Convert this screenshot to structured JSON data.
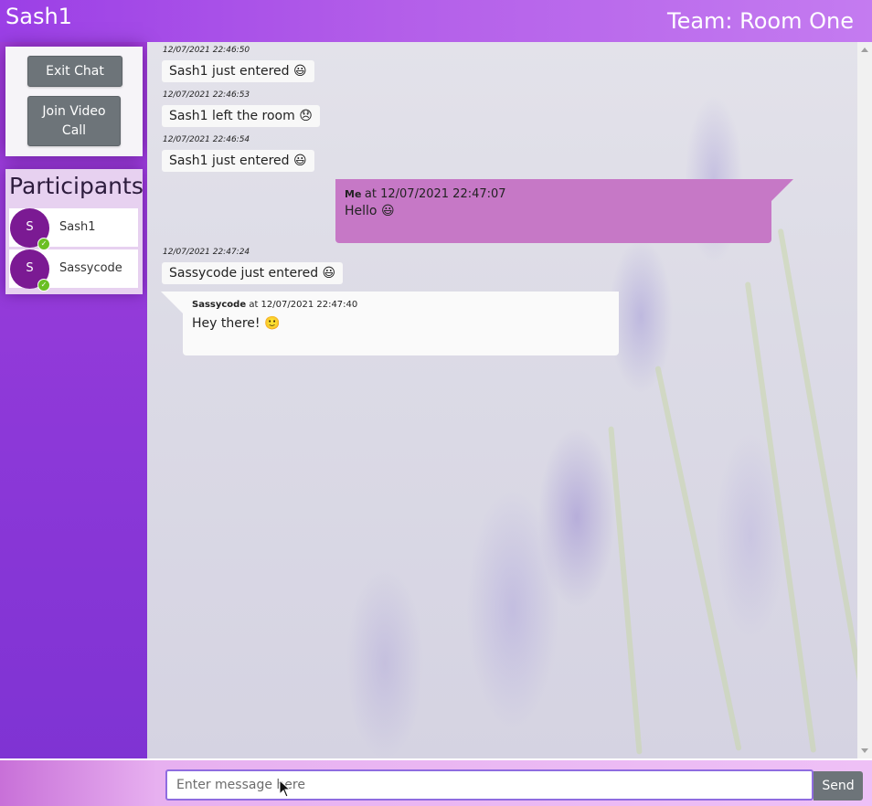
{
  "header": {
    "user_name": "Sash1",
    "team_label": "Team: Room One"
  },
  "sidebar": {
    "exit_label": "Exit Chat",
    "video_label_line1": "Join Video",
    "video_label_line2": "Call",
    "participants_title": "Participants",
    "participants": [
      {
        "initial": "S",
        "name": "Sash1",
        "status": "online"
      },
      {
        "initial": "S",
        "name": "Sassycode",
        "status": "online"
      }
    ]
  },
  "messages": {
    "system": [
      {
        "time": "12/07/2021 22:46:50",
        "text": "Sash1 just entered",
        "emoji": "😃"
      },
      {
        "time": "12/07/2021 22:46:53",
        "text": "Sash1 left the room",
        "emoji": "😞"
      },
      {
        "time": "12/07/2021 22:46:54",
        "text": "Sash1 just entered",
        "emoji": "😃"
      },
      {
        "time": "12/07/2021 22:47:24",
        "text": "Sassycode just entered",
        "emoji": "😃"
      }
    ],
    "me": {
      "sender": "Me",
      "at": "at 12/07/2021 22:47:07",
      "text": "Hello",
      "emoji": "😃",
      "color": "#c678c6"
    },
    "other": {
      "sender": "Sassycode",
      "at": "at 12/07/2021 22:47:40",
      "text": "Hey there!",
      "emoji": "🙂",
      "color": "#fafafa"
    }
  },
  "composer": {
    "placeholder": "Enter message here",
    "send_label": "Send"
  },
  "colors": {
    "accent": "#9b3fe6",
    "button": "#6d7479",
    "status_online": "#6abf23"
  }
}
